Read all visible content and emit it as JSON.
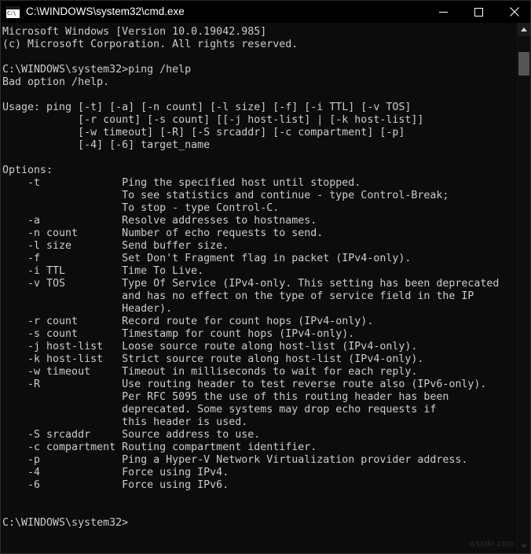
{
  "window": {
    "title": "C:\\WINDOWS\\system32\\cmd.exe",
    "icon_name": "cmd-icon",
    "icon_glyph": "C:\\",
    "background_color": "#0c0c0c",
    "titlebar_color": "#000000",
    "text_color": "#cccccc"
  },
  "titlebar": {
    "minimize_label": "Minimize",
    "maximize_label": "Maximize",
    "close_label": "Close"
  },
  "scrollbar": {
    "up_arrow_label": "Scroll up",
    "down_arrow_label": "Scroll down",
    "thumb_label": "Scroll thumb",
    "thumb_color": "#555555"
  },
  "watermark": {
    "text": "wsxdn.com"
  },
  "console": {
    "prompt_path": "C:\\WINDOWS\\system32>",
    "command": "ping /help",
    "error": "Bad option /help.",
    "version_line": "Microsoft Windows [Version 10.0.19042.985]",
    "copyright_line": "(c) Microsoft Corporation. All rights reserved.",
    "content": "Microsoft Windows [Version 10.0.19042.985]\n(c) Microsoft Corporation. All rights reserved.\n\nC:\\WINDOWS\\system32>ping /help\nBad option /help.\n\nUsage: ping [-t] [-a] [-n count] [-l size] [-f] [-i TTL] [-v TOS]\n            [-r count] [-s count] [[-j host-list] | [-k host-list]]\n            [-w timeout] [-R] [-S srcaddr] [-c compartment] [-p]\n            [-4] [-6] target_name\n\nOptions:\n    -t             Ping the specified host until stopped.\n                   To see statistics and continue - type Control-Break;\n                   To stop - type Control-C.\n    -a             Resolve addresses to hostnames.\n    -n count       Number of echo requests to send.\n    -l size        Send buffer size.\n    -f             Set Don't Fragment flag in packet (IPv4-only).\n    -i TTL         Time To Live.\n    -v TOS         Type Of Service (IPv4-only. This setting has been deprecated\n                   and has no effect on the type of service field in the IP\n                   Header).\n    -r count       Record route for count hops (IPv4-only).\n    -s count       Timestamp for count hops (IPv4-only).\n    -j host-list   Loose source route along host-list (IPv4-only).\n    -k host-list   Strict source route along host-list (IPv4-only).\n    -w timeout     Timeout in milliseconds to wait for each reply.\n    -R             Use routing header to test reverse route also (IPv6-only).\n                   Per RFC 5095 the use of this routing header has been\n                   deprecated. Some systems may drop echo requests if\n                   this header is used.\n    -S srcaddr     Source address to use.\n    -c compartment Routing compartment identifier.\n    -p             Ping a Hyper-V Network Virtualization provider address.\n    -4             Force using IPv4.\n    -6             Force using IPv6.\n\n\nC:\\WINDOWS\\system32>"
  }
}
